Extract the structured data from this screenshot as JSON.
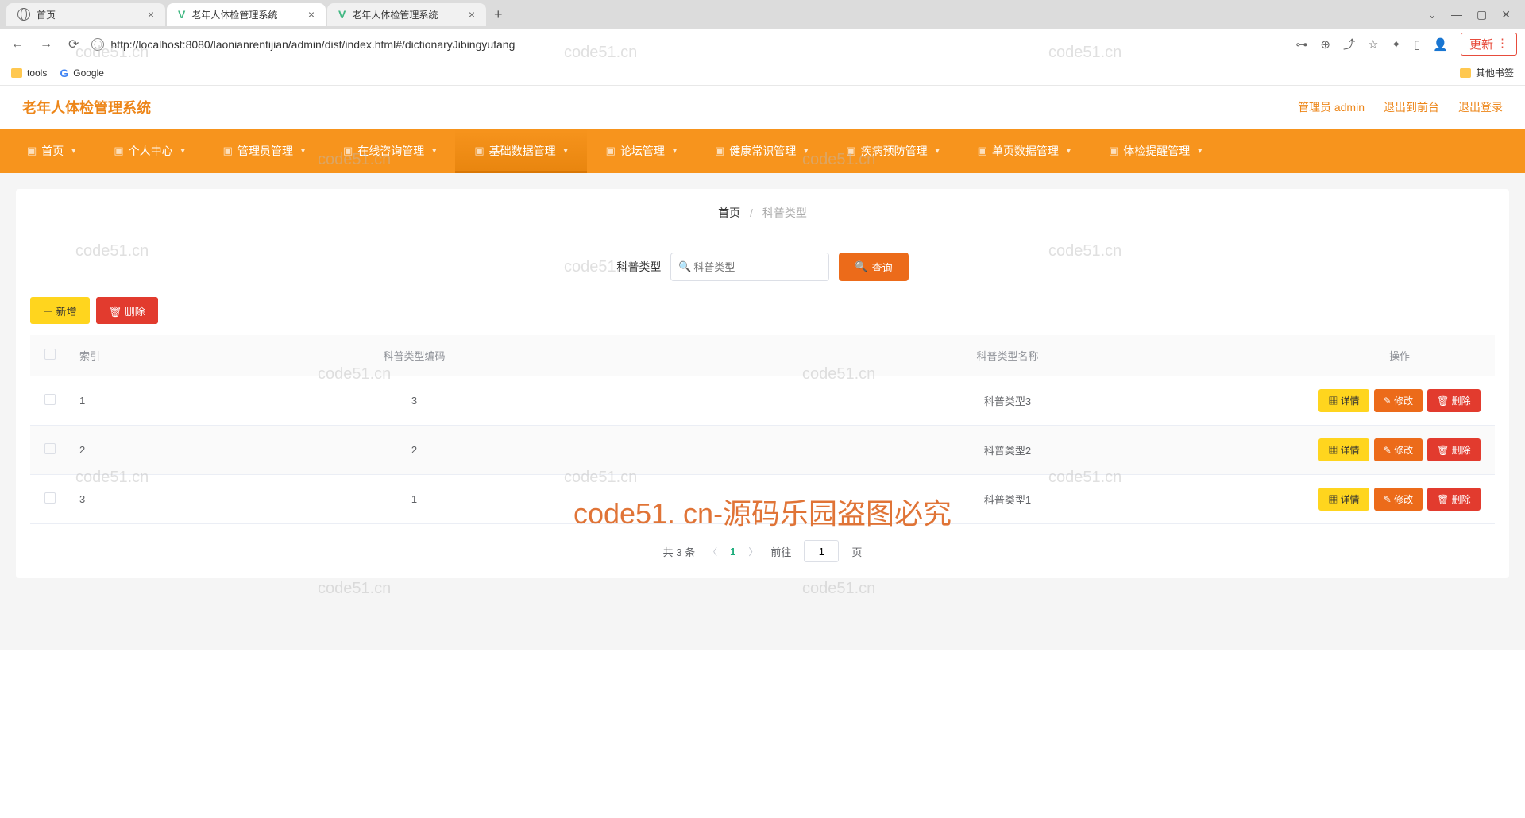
{
  "browser": {
    "tabs": [
      {
        "title": "首页",
        "icon": "globe"
      },
      {
        "title": "老年人体检管理系统",
        "icon": "vue",
        "active": true
      },
      {
        "title": "老年人体检管理系统",
        "icon": "vue"
      }
    ],
    "url": "http://localhost:8080/laonianrentijian/admin/dist/index.html#/dictionaryJibingyufang",
    "update_btn": "更新",
    "bookmarks": {
      "tools": "tools",
      "google": "Google",
      "other": "其他书签"
    }
  },
  "header": {
    "title": "老年人体检管理系统",
    "admin": "管理员 admin",
    "to_front": "退出到前台",
    "logout": "退出登录"
  },
  "nav": [
    {
      "label": "首页"
    },
    {
      "label": "个人中心"
    },
    {
      "label": "管理员管理"
    },
    {
      "label": "在线咨询管理"
    },
    {
      "label": "基础数据管理",
      "active": true
    },
    {
      "label": "论坛管理"
    },
    {
      "label": "健康常识管理"
    },
    {
      "label": "疾病预防管理"
    },
    {
      "label": "单页数据管理"
    },
    {
      "label": "体检提醒管理"
    }
  ],
  "breadcrumb": {
    "home": "首页",
    "current": "科普类型"
  },
  "search": {
    "label": "科普类型",
    "placeholder": "科普类型",
    "btn": "查询"
  },
  "actions": {
    "add": "新增",
    "delete": "删除"
  },
  "table": {
    "headers": {
      "index": "索引",
      "code": "科普类型编码",
      "name": "科普类型名称",
      "ops": "操作"
    },
    "rows": [
      {
        "index": "1",
        "code": "3",
        "name": "科普类型3"
      },
      {
        "index": "2",
        "code": "2",
        "name": "科普类型2"
      },
      {
        "index": "3",
        "code": "1",
        "name": "科普类型1"
      }
    ],
    "op_labels": {
      "detail": "详情",
      "edit": "修改",
      "delete": "删除"
    }
  },
  "pagination": {
    "total": "共 3 条",
    "page": "1",
    "goto": "前往",
    "page_suffix": "页",
    "goto_val": "1"
  },
  "watermark": {
    "text": "code51.cn",
    "big": "code51. cn-源码乐园盗图必究"
  }
}
